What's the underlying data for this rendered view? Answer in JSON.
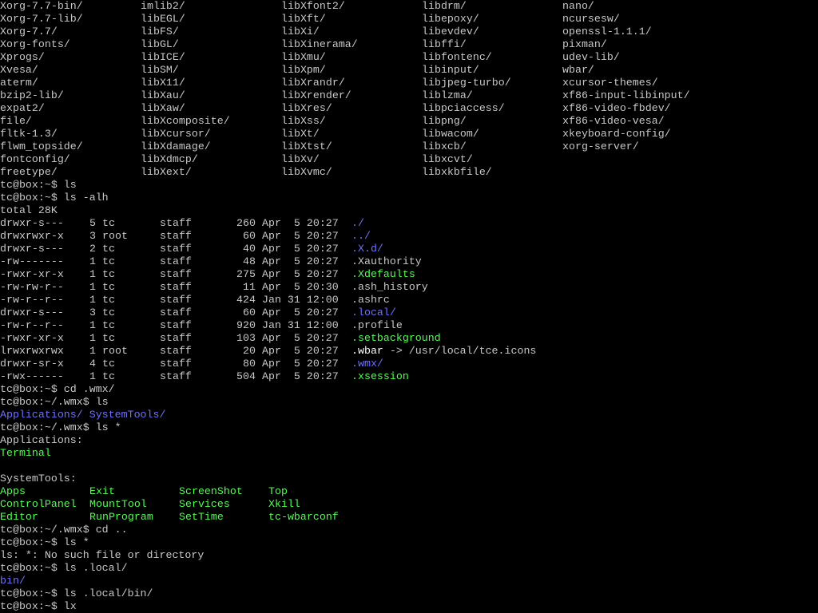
{
  "terminal": {
    "title": "",
    "listing_grid": {
      "rows": [
        [
          "Xorg-7.7-bin/",
          "imlib2/",
          "libXfont2/",
          "libdrm/",
          "nano/"
        ],
        [
          "Xorg-7.7-lib/",
          "libEGL/",
          "libXft/",
          "libepoxy/",
          "ncursesw/"
        ],
        [
          "Xorg-7.7/",
          "libFS/",
          "libXi/",
          "libevdev/",
          "openssl-1.1.1/"
        ],
        [
          "Xorg-fonts/",
          "libGL/",
          "libXinerama/",
          "libffi/",
          "pixman/"
        ],
        [
          "Xprogs/",
          "libICE/",
          "libXmu/",
          "libfontenc/",
          "udev-lib/"
        ],
        [
          "Xvesa/",
          "libSM/",
          "libXpm/",
          "libinput/",
          "wbar/"
        ],
        [
          "aterm/",
          "libX11/",
          "libXrandr/",
          "libjpeg-turbo/",
          "xcursor-themes/"
        ],
        [
          "bzip2-lib/",
          "libXau/",
          "libXrender/",
          "liblzma/",
          "xf86-input-libinput/"
        ],
        [
          "expat2/",
          "libXaw/",
          "libXres/",
          "libpciaccess/",
          "xf86-video-fbdev/"
        ],
        [
          "file/",
          "libXcomposite/",
          "libXss/",
          "libpng/",
          "xf86-video-vesa/"
        ],
        [
          "fltk-1.3/",
          "libXcursor/",
          "libXt/",
          "libwacom/",
          "xkeyboard-config/"
        ],
        [
          "flwm_topside/",
          "libXdamage/",
          "libXtst/",
          "libxcb/",
          "xorg-server/"
        ],
        [
          "fontconfig/",
          "libXdmcp/",
          "libXv/",
          "libxcvt/",
          ""
        ],
        [
          "freetype/",
          "libXext/",
          "libXvmc/",
          "libxkbfile/",
          ""
        ]
      ]
    },
    "session_1": [
      {
        "prompt": "tc@box:~$ ",
        "cmd": "ls"
      },
      {
        "prompt": "tc@box:~$ ",
        "cmd": "ls -alh"
      }
    ],
    "total_line": "total 28K",
    "ls_long": {
      "rows": [
        {
          "perm": "drwxr-s---",
          "links": "5",
          "owner": "tc",
          "group": "staff",
          "size": "260",
          "date": "Apr  5 20:27",
          "name": "./",
          "color": "blue",
          "target": ""
        },
        {
          "perm": "drwxrwxr-x",
          "links": "3",
          "owner": "root",
          "group": "staff",
          "size": "60",
          "date": "Apr  5 20:27",
          "name": "../",
          "color": "blue",
          "target": ""
        },
        {
          "perm": "drwxr-s---",
          "links": "2",
          "owner": "tc",
          "group": "staff",
          "size": "40",
          "date": "Apr  5 20:27",
          "name": ".X.d/",
          "color": "blue",
          "target": ""
        },
        {
          "perm": "-rw-------",
          "links": "1",
          "owner": "tc",
          "group": "staff",
          "size": "48",
          "date": "Apr  5 20:27",
          "name": ".Xauthority",
          "color": "gray",
          "target": ""
        },
        {
          "perm": "-rwxr-xr-x",
          "links": "1",
          "owner": "tc",
          "group": "staff",
          "size": "275",
          "date": "Apr  5 20:27",
          "name": ".Xdefaults",
          "color": "green",
          "target": ""
        },
        {
          "perm": "-rw-rw-r--",
          "links": "1",
          "owner": "tc",
          "group": "staff",
          "size": "11",
          "date": "Apr  5 20:30",
          "name": ".ash_history",
          "color": "gray",
          "target": ""
        },
        {
          "perm": "-rw-r--r--",
          "links": "1",
          "owner": "tc",
          "group": "staff",
          "size": "424",
          "date": "Jan 31 12:00",
          "name": ".ashrc",
          "color": "gray",
          "target": ""
        },
        {
          "perm": "drwxr-s---",
          "links": "3",
          "owner": "tc",
          "group": "staff",
          "size": "60",
          "date": "Apr  5 20:27",
          "name": ".local/",
          "color": "blue",
          "target": ""
        },
        {
          "perm": "-rw-r--r--",
          "links": "1",
          "owner": "tc",
          "group": "staff",
          "size": "920",
          "date": "Jan 31 12:00",
          "name": ".profile",
          "color": "gray",
          "target": ""
        },
        {
          "perm": "-rwxr-xr-x",
          "links": "1",
          "owner": "tc",
          "group": "staff",
          "size": "103",
          "date": "Apr  5 20:27",
          "name": ".setbackground",
          "color": "green",
          "target": ""
        },
        {
          "perm": "lrwxrwxrwx",
          "links": "1",
          "owner": "root",
          "group": "staff",
          "size": "20",
          "date": "Apr  5 20:27",
          "name": ".wbar",
          "color": "white",
          "target": " -> /usr/local/tce.icons"
        },
        {
          "perm": "drwxr-sr-x",
          "links": "4",
          "owner": "tc",
          "group": "staff",
          "size": "80",
          "date": "Apr  5 20:27",
          "name": ".wmx/",
          "color": "blue",
          "target": ""
        },
        {
          "perm": "-rwx------",
          "links": "1",
          "owner": "tc",
          "group": "staff",
          "size": "504",
          "date": "Apr  5 20:27",
          "name": ".xsession",
          "color": "green",
          "target": ""
        }
      ]
    },
    "session_2": [
      {
        "prompt": "tc@box:~$ ",
        "cmd": "cd .wmx/"
      },
      {
        "prompt": "tc@box:~/.wmx$ ",
        "cmd": "ls"
      }
    ],
    "wmx_ls": [
      {
        "name": "Applications/",
        "color": "blue"
      },
      {
        "name": "SystemTools/",
        "color": "blue"
      }
    ],
    "session_3": {
      "prompt": "tc@box:~/.wmx$ ",
      "cmd": "ls *"
    },
    "apps_header": "Applications:",
    "apps_items": [
      {
        "name": "Terminal",
        "color": "green"
      }
    ],
    "systools_header": "SystemTools:",
    "systools_grid": [
      [
        "Apps",
        "Exit",
        "ScreenShot",
        "Top"
      ],
      [
        "ControlPanel",
        "MountTool",
        "Services",
        "Xkill"
      ],
      [
        "Editor",
        "RunProgram",
        "SetTime",
        "tc-wbarconf"
      ]
    ],
    "session_4": [
      {
        "prompt": "tc@box:~/.wmx$ ",
        "cmd": "cd .."
      },
      {
        "prompt": "tc@box:~$ ",
        "cmd": "ls *"
      }
    ],
    "error_line": "ls: *: No such file or directory",
    "session_5": {
      "prompt": "tc@box:~$ ",
      "cmd": "ls .local/"
    },
    "local_items": [
      {
        "name": "bin/",
        "color": "blue"
      }
    ],
    "session_6": {
      "prompt": "tc@box:~$ ",
      "cmd": "ls .local/bin/"
    },
    "session_7": {
      "prompt": "tc@box:~$ ",
      "cmd": "lx"
    },
    "colors": {
      "background": "#000000",
      "foreground": "#c8c8c8",
      "executable": "#54fc54",
      "directory": "#7070ff",
      "symlink": "#ffffff"
    }
  }
}
